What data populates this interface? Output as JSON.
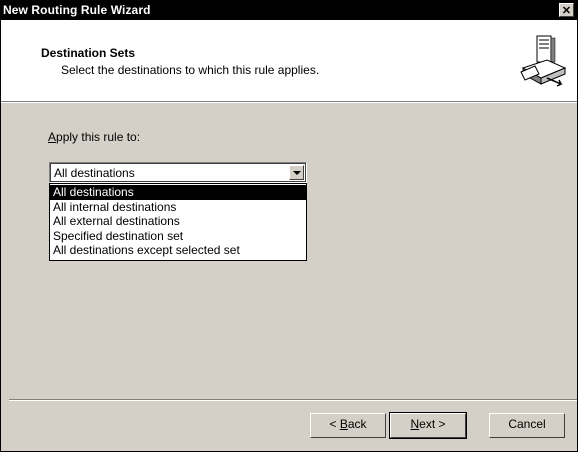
{
  "window": {
    "title": "New Routing Rule Wizard",
    "close_glyph": "✕"
  },
  "header": {
    "title": "Destination Sets",
    "subtitle": "Select the destinations to which this rule applies.",
    "icon": "routing-computer-icon"
  },
  "apply": {
    "label_mnemonic": "A",
    "label_rest": "pply this rule to:",
    "combo_value": "All destinations",
    "options": [
      "All destinations",
      "All internal destinations",
      "All external destinations",
      "Specified destination set",
      "All destinations except selected set"
    ],
    "selected_index": 0
  },
  "buttons": {
    "back_prefix": "< ",
    "back_mnemonic": "B",
    "back_rest": "ack",
    "next_mnemonic": "N",
    "next_rest": "ext >",
    "cancel": "Cancel"
  }
}
